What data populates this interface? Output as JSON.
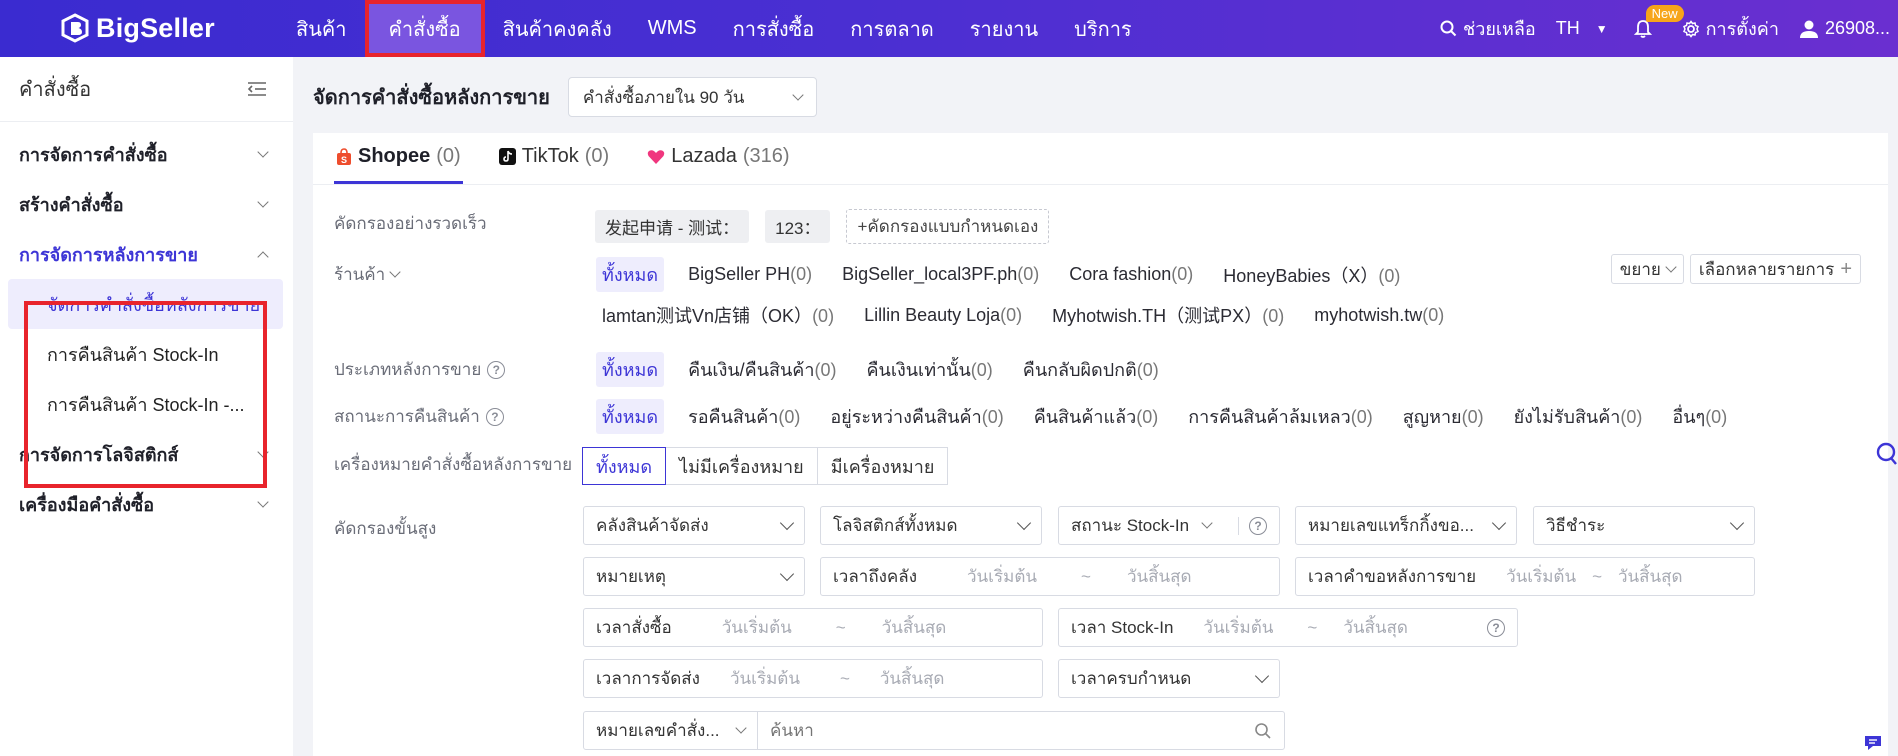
{
  "brand": {
    "name": "BigSeller"
  },
  "nav": [
    {
      "label": "สินค้า",
      "active": false
    },
    {
      "label": "คำสั่งซื้อ",
      "active": true
    },
    {
      "label": "สินค้าคงคลัง",
      "active": false
    },
    {
      "label": "WMS",
      "active": false
    },
    {
      "label": "การสั่งซื้อ",
      "active": false
    },
    {
      "label": "การตลาด",
      "active": false
    },
    {
      "label": "รายงาน",
      "active": false
    },
    {
      "label": "บริการ",
      "active": false
    }
  ],
  "topright": {
    "help": "ช่วยเหลือ",
    "lang": "TH",
    "new_badge": "New",
    "settings": "การตั้งค่า",
    "user": "26908..."
  },
  "sidebar": {
    "title": "คำสั่งซื้อ",
    "groups": [
      {
        "label": "การจัดการคำสั่งซื้อ"
      },
      {
        "label": "สร้างคำสั่งซื้อ"
      },
      {
        "label": "การจัดการหลังการขาย"
      },
      {
        "label": "การจัดการโลจิสติกส์"
      },
      {
        "label": "เครื่องมือคำสั่งซื้อ"
      }
    ],
    "subitems": [
      {
        "label": "จัดการคำสั่งซื้อหลังการขาย"
      },
      {
        "label": "การคืนสินค้า Stock-In"
      },
      {
        "label": "การคืนสินค้า Stock-In -..."
      }
    ]
  },
  "main": {
    "page_title": "จัดการคำสั่งซื้อหลังการขาย",
    "range_select": "คำสั่งซื้อภายใน 90 วัน",
    "tabs": [
      {
        "name": "Shopee",
        "count": "(0)"
      },
      {
        "name": "TikTok",
        "count": "(0)"
      },
      {
        "name": "Lazada",
        "count": "(316)"
      }
    ],
    "quick_filter": {
      "label": "คัดกรองอย่างรวดเร็ว",
      "chips": [
        "发起申请 - 测试：",
        "123："
      ],
      "custom": "+คัดกรองแบบกำหนดเอง"
    },
    "store": {
      "label": "ร้านค้า",
      "expand": "ขยาย",
      "multi": "เลือกหลายรายการ",
      "row1": [
        {
          "name": "ทั้งหมด",
          "count": ""
        },
        {
          "name": "BigSeller PH",
          "count": "(0)"
        },
        {
          "name": "BigSeller_local3PF.ph",
          "count": "(0)"
        },
        {
          "name": "Cora fashion",
          "count": "(0)"
        },
        {
          "name": "HoneyBabies（X）",
          "count": "(0)"
        }
      ],
      "row2": [
        {
          "name": "lamtan测试Vn店铺（OK）",
          "count": "(0)"
        },
        {
          "name": "Lillin Beauty Loja",
          "count": "(0)"
        },
        {
          "name": "Myhotwish.TH（测试PX）",
          "count": "(0)"
        },
        {
          "name": "myhotwish.tw",
          "count": "(0)"
        }
      ]
    },
    "type": {
      "label": "ประเภทหลังการขาย",
      "options": [
        {
          "name": "ทั้งหมด",
          "count": ""
        },
        {
          "name": "คืนเงิน/คืนสินค้า",
          "count": "(0)"
        },
        {
          "name": "คืนเงินเท่านั้น",
          "count": "(0)"
        },
        {
          "name": "คืนกลับผิดปกติ",
          "count": "(0)"
        }
      ]
    },
    "status": {
      "label": "สถานะการคืนสินค้า",
      "options": [
        {
          "name": "ทั้งหมด",
          "count": ""
        },
        {
          "name": "รอคืนสินค้า",
          "count": "(0)"
        },
        {
          "name": "อยู่ระหว่างคืนสินค้า",
          "count": "(0)"
        },
        {
          "name": "คืนสินค้าแล้ว",
          "count": "(0)"
        },
        {
          "name": "การคืนสินค้าล้มเหลว",
          "count": "(0)"
        },
        {
          "name": "สูญหาย",
          "count": "(0)"
        },
        {
          "name": "ยังไม่รับสินค้า",
          "count": "(0)"
        },
        {
          "name": "อื่นๆ",
          "count": "(0)"
        }
      ]
    },
    "mark": {
      "label": "เครื่องหมายคำสั่งซื้อหลังการขาย",
      "options": [
        "ทั้งหมด",
        "ไม่มีเครื่องหมาย",
        "มีเครื่องหมาย"
      ]
    },
    "advanced": {
      "label": "คัดกรองขั้นสูง",
      "warehouse": "คลังสินค้าจัดส่ง",
      "logistics": "โลจิสติกส์ทั้งหมด",
      "stockin_status": "สถานะ Stock-In",
      "tracking": "หมายเลขแทร็กกิ้งขอ...",
      "payment": "วิธีชำระ",
      "reason": "หมายเหตุ",
      "arrive_time": "เวลาถึงคลัง",
      "request_time": "เวลาคำขอหลังการขาย",
      "order_time": "เวลาสั่งซื้อ",
      "stockin_time": "เวลา Stock-In",
      "ship_time": "เวลาการจัดส่ง",
      "deadline": "เวลาครบกำหนด",
      "order_no": "หมายเลขคำสั่ง...",
      "start_ph": "วันเริ่มต้น",
      "end_ph": "วันสิ้นสุด",
      "tilde": "~",
      "search_ph": "ค้นหา"
    }
  }
}
